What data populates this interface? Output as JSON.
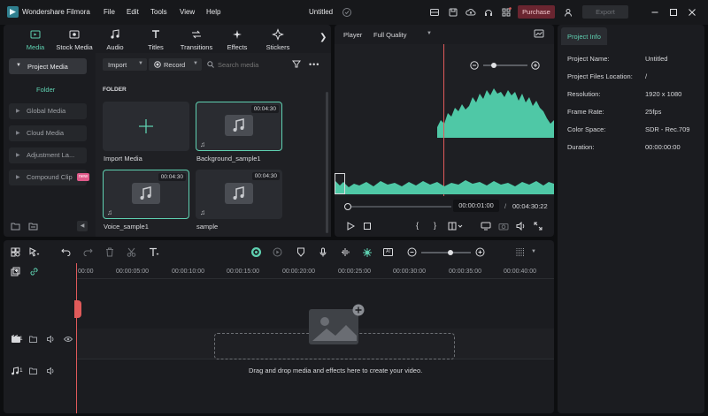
{
  "app": {
    "name": "Wondershare Filmora",
    "project_title": "Untitled"
  },
  "menu": [
    "File",
    "Edit",
    "Tools",
    "View",
    "Help"
  ],
  "titlebar": {
    "purchase": "Purchase",
    "export": "Export"
  },
  "tabs": [
    "Media",
    "Stock Media",
    "Audio",
    "Titles",
    "Transitions",
    "Effects",
    "Stickers"
  ],
  "sidebar": {
    "project_media": "Project Media",
    "folder": "Folder",
    "items": [
      "Global Media",
      "Cloud Media",
      "Adjustment La...",
      "Compound Clip"
    ],
    "compound_badge": "new"
  },
  "media_toolbar": {
    "import": "Import",
    "record": "Record",
    "search_placeholder": "Search media"
  },
  "folder_heading": "FOLDER",
  "media_items": [
    {
      "label": "Import Media",
      "duration": ""
    },
    {
      "label": "Background_sample1",
      "duration": "00:04:30"
    },
    {
      "label": "Voice_sample1",
      "duration": "00:04:30"
    },
    {
      "label": "sample",
      "duration": "00:04:30"
    }
  ],
  "player": {
    "label": "Player",
    "quality": "Full Quality",
    "current_time": "00:00:01:00",
    "separator": "/",
    "total_time": "00:04:30:22"
  },
  "project_info": {
    "tab": "Project Info",
    "rows": [
      {
        "label": "Project Name:",
        "value": "Untitled"
      },
      {
        "label": "Project Files Location:",
        "value": "/"
      },
      {
        "label": "Resolution:",
        "value": "1920 x 1080"
      },
      {
        "label": "Frame Rate:",
        "value": "25fps"
      },
      {
        "label": "Color Space:",
        "value": "SDR - Rec.709"
      },
      {
        "label": "Duration:",
        "value": "00:00:00:00"
      }
    ]
  },
  "timeline": {
    "ruler": [
      "00:00",
      "00:00:05:00",
      "00:00:10:00",
      "00:00:15:00",
      "00:00:20:00",
      "00:00:25:00",
      "00:00:30:00",
      "00:00:35:00",
      "00:00:40:00"
    ],
    "video_track_num": "1",
    "audio_track_num": "1",
    "drop_hint": "Drag and drop media and effects here to create your video."
  },
  "colors": {
    "accent": "#5fd1b1",
    "playhead": "#e05a5a",
    "purchase": "#6a2530"
  }
}
